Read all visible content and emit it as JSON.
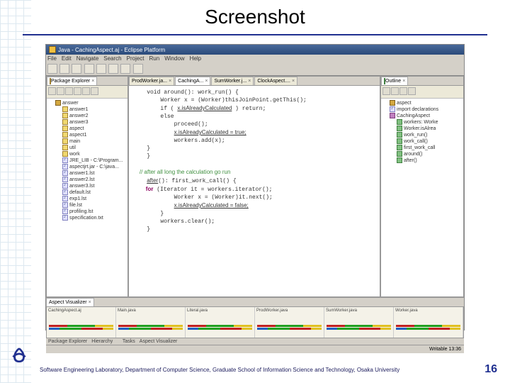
{
  "slide": {
    "title": "Screenshot",
    "page": "16",
    "footer": "Software Engineering Laboratory, Department of Computer Science, Graduate School of Information Science and Technology, Osaka University"
  },
  "titlebar": {
    "text": "Java - CachingAspect.aj - Eclipse Platform"
  },
  "menu": [
    "File",
    "Edit",
    "Navigate",
    "Search",
    "Project",
    "Run",
    "Window",
    "Help"
  ],
  "left": {
    "tab": "Package Explorer",
    "items": [
      {
        "icon": "pkg",
        "label": "answer",
        "ind": 1
      },
      {
        "icon": "fld",
        "label": "answer1",
        "ind": 2
      },
      {
        "icon": "fld",
        "label": "answer2",
        "ind": 2
      },
      {
        "icon": "fld",
        "label": "answer3",
        "ind": 2
      },
      {
        "icon": "fld",
        "label": "aspect",
        "ind": 2
      },
      {
        "icon": "fld",
        "label": "aspect1",
        "ind": 2
      },
      {
        "icon": "fld",
        "label": "main",
        "ind": 2
      },
      {
        "icon": "fld",
        "label": "util",
        "ind": 2
      },
      {
        "icon": "fld",
        "label": "work",
        "ind": 2
      },
      {
        "icon": "jfile",
        "label": "JRE_LIB - C:\\Program...",
        "ind": 2
      },
      {
        "icon": "jfile",
        "label": "aspectjrt.jar - C:\\java...",
        "ind": 2
      },
      {
        "icon": "jfile",
        "label": "answer1.lst",
        "ind": 2
      },
      {
        "icon": "jfile",
        "label": "answer2.lst",
        "ind": 2
      },
      {
        "icon": "jfile",
        "label": "answer3.lst",
        "ind": 2
      },
      {
        "icon": "jfile",
        "label": "default.lst",
        "ind": 2
      },
      {
        "icon": "jfile",
        "label": "exp1.lst",
        "ind": 2
      },
      {
        "icon": "jfile",
        "label": "file.lst",
        "ind": 2
      },
      {
        "icon": "jfile",
        "label": "profiling.lst",
        "ind": 2
      },
      {
        "icon": "jfile",
        "label": "specification.txt",
        "ind": 2
      }
    ],
    "bottom_tabs": [
      "Package Explorer",
      "Hierarchy"
    ]
  },
  "center": {
    "tabs": [
      "ProdWorker.ja...",
      "CachingA...",
      "SumWorker.j...",
      "ClockAspect...."
    ],
    "active_tab": 1,
    "code": [
      {
        "t": "    void around(): work_run() {"
      },
      {
        "t": "        Worker x = (Worker)thisJoinPoint.getThis();"
      },
      {
        "t": "        if ( ",
        "u": "x.isAlreadyCalculated",
        "t2": " ) return;"
      },
      {
        "t": "        else"
      },
      {
        "t": "            proceed();"
      },
      {
        "t": "            ",
        "u": "x.isAlreadyCalculated = true;",
        "t2": ""
      },
      {
        "t": "            workers.add(x);"
      },
      {
        "t": "    }"
      },
      {
        "t": "    }"
      },
      {
        "t": ""
      },
      {
        "cm": "    // after all long the calculation go run"
      },
      {
        "t": "    ",
        "u": "after",
        "t2": "(): first_work_call() {"
      },
      {
        "kw": "        for",
        "t2": " (Iterator it = workers.iterator();"
      },
      {
        "t": "            Worker x = (Worker)it.next();"
      },
      {
        "t": "            ",
        "u": "x.isAlreadyCalculated = false;",
        "t2": ""
      },
      {
        "t": "        }"
      },
      {
        "t": "        workers.clear();"
      },
      {
        "t": "    }"
      }
    ],
    "bottom_tabs": [
      "Tasks",
      "Aspect Visualizer"
    ]
  },
  "right": {
    "tab": "Outline",
    "items": [
      {
        "icon": "pkg",
        "label": "aspect",
        "ind": 1
      },
      {
        "icon": "jfile",
        "label": "import declarations",
        "ind": 1
      },
      {
        "icon": "asp",
        "label": "CachingAspect",
        "ind": 1
      },
      {
        "icon": "meth",
        "label": "workers: Worke",
        "ind": 2
      },
      {
        "icon": "meth",
        "label": "Worker.isAlrea",
        "ind": 2
      },
      {
        "icon": "meth",
        "label": "work_run()",
        "ind": 2
      },
      {
        "icon": "meth",
        "label": "work_call()",
        "ind": 2
      },
      {
        "icon": "meth",
        "label": "first_work_call",
        "ind": 2
      },
      {
        "icon": "meth",
        "label": "around()",
        "ind": 2
      },
      {
        "icon": "meth",
        "label": "after()",
        "ind": 2
      }
    ]
  },
  "visualizer": {
    "tab": "Aspect Visualizer",
    "cols": [
      "CachingAspect.aj",
      "Main.java",
      "Literal.java",
      "ProdWorker.java",
      "SumWorker.java",
      "Worker.java"
    ]
  },
  "status": {
    "left": "",
    "right": "Writable             13:36"
  }
}
